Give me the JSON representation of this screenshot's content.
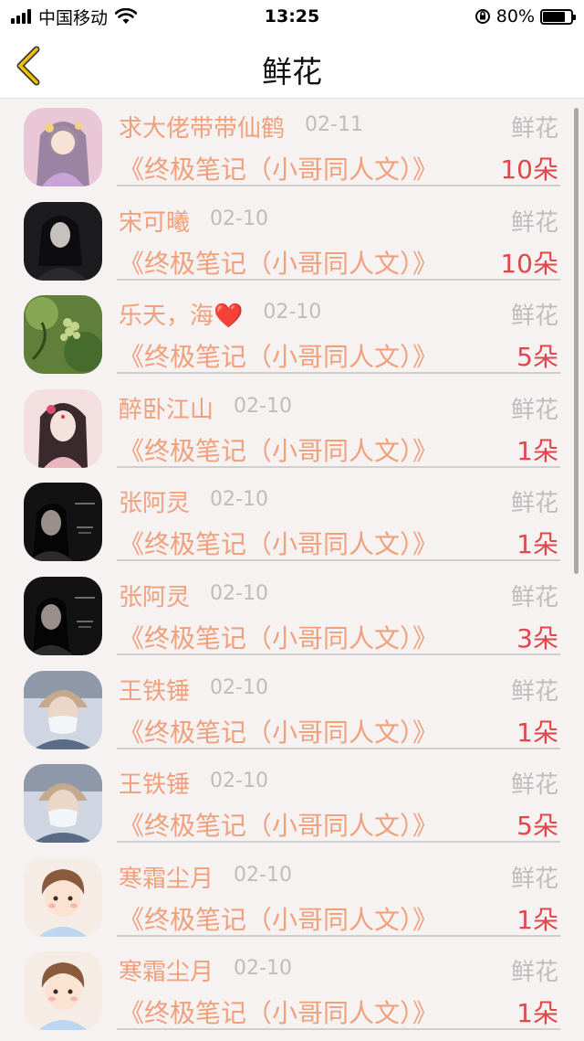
{
  "status_bar": {
    "carrier": "中国移动",
    "time": "13:25",
    "battery": "80%",
    "battery_level": 0.8
  },
  "nav": {
    "title": "鲜花",
    "back_icon": "chevron-left-icon",
    "accent_color": "#f2c200"
  },
  "rows": [
    {
      "name": "求大佬带带仙鹤",
      "date": "02-11",
      "gift": "鲜花",
      "book": "《终极笔记（小哥同人文）》",
      "count": "10朵",
      "avatar": "anime-girl-pink"
    },
    {
      "name": "宋可曦",
      "date": "02-10",
      "gift": "鲜花",
      "book": "《终极笔记（小哥同人文）》",
      "count": "10朵",
      "avatar": "dark-portrait"
    },
    {
      "name": "乐天，海❤️",
      "date": "02-10",
      "gift": "鲜花",
      "book": "《终极笔记（小哥同人文）》",
      "count": "5朵",
      "avatar": "green-grapes"
    },
    {
      "name": "醉卧江山",
      "date": "02-10",
      "gift": "鲜花",
      "book": "《终极笔记（小哥同人文）》",
      "count": "1朵",
      "avatar": "ancient-beauty"
    },
    {
      "name": "张阿灵",
      "date": "02-10",
      "gift": "鲜花",
      "book": "《终极笔记（小哥同人文）》",
      "count": "1朵",
      "avatar": "dark-girl"
    },
    {
      "name": "张阿灵",
      "date": "02-10",
      "gift": "鲜花",
      "book": "《终极笔记（小哥同人文）》",
      "count": "3朵",
      "avatar": "dark-girl"
    },
    {
      "name": "王铁锤",
      "date": "02-10",
      "gift": "鲜花",
      "book": "《终极笔记（小哥同人文）》",
      "count": "1朵",
      "avatar": "cap-mask"
    },
    {
      "name": "王铁锤",
      "date": "02-10",
      "gift": "鲜花",
      "book": "《终极笔记（小哥同人文）》",
      "count": "5朵",
      "avatar": "cap-mask"
    },
    {
      "name": "寒霜尘月",
      "date": "02-10",
      "gift": "鲜花",
      "book": "《终极笔记（小哥同人文）》",
      "count": "1朵",
      "avatar": "cartoon-boy"
    },
    {
      "name": "寒霜尘月",
      "date": "02-10",
      "gift": "鲜花",
      "book": "《终极笔记（小哥同人文）》",
      "count": "1朵",
      "avatar": "cartoon-boy"
    }
  ]
}
